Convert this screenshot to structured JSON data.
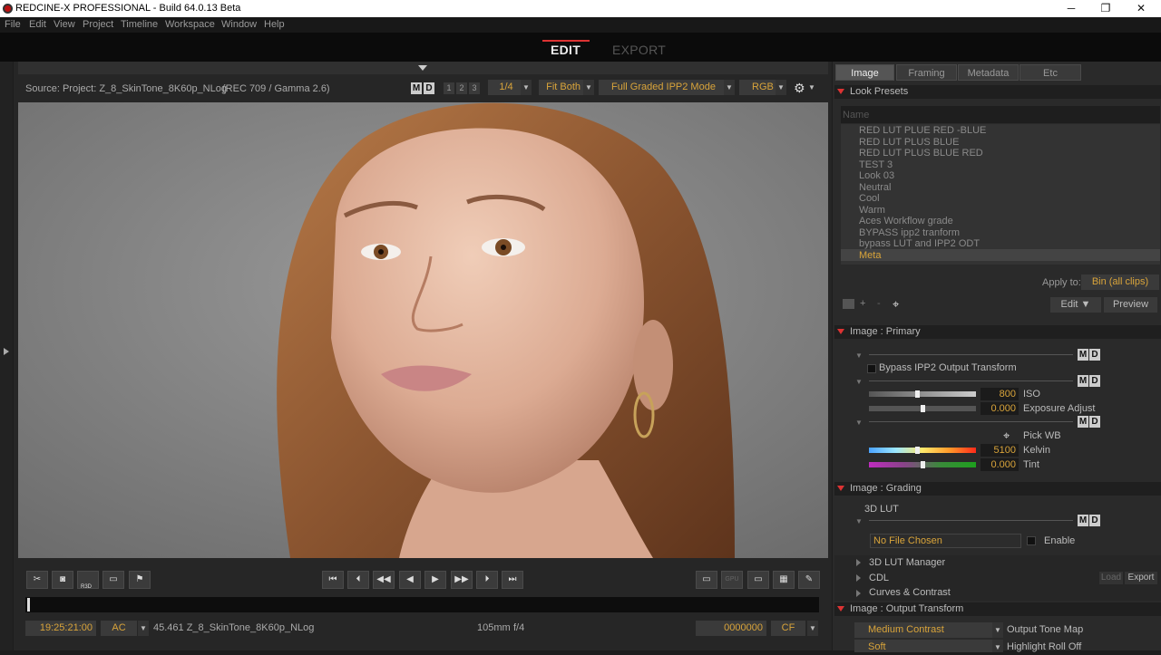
{
  "window": {
    "title": "REDCINE-X PROFESSIONAL - Build 64.0.13 Beta",
    "controls": [
      "─",
      "❐",
      "✕"
    ]
  },
  "menu": [
    "File",
    "Edit",
    "View",
    "Project",
    "Timeline",
    "Workspace",
    "Window",
    "Help"
  ],
  "modes": {
    "edit": "EDIT",
    "export": "EXPORT"
  },
  "viewer": {
    "source": "Source: Project: Z_8_SkinTone_8K60p_NLog",
    "colorspace": "(REC 709 / Gamma 2.6)",
    "md": [
      "M",
      "D"
    ],
    "nums": [
      "1",
      "2",
      "3"
    ],
    "resolution": "1/4",
    "fit": "Fit Both",
    "mode": "Full Graded IPP2 Mode",
    "channel": "RGB"
  },
  "transport": {
    "timecode": "19:25:21:00",
    "ac": "AC",
    "clip": "45.461 Z_8_SkinTone_8K60p_NLog",
    "lens": "105mm",
    "aperture": "f/4",
    "frame": "0000000",
    "cf": "CF",
    "gpu": "GPU",
    "r3d": "R3D"
  },
  "panel": {
    "tabs": [
      "Image",
      "Framing",
      "Metadata",
      "Etc"
    ],
    "look_presets": {
      "header": "Look Presets",
      "name_placeholder": "Name",
      "items": [
        "RED LUT PLUE RED -BLUE",
        "RED LUT PLUS BLUE",
        "RED LUT PLUS BLUE RED",
        "TEST 3",
        "Look 03",
        "Neutral",
        "Cool",
        "Warm",
        "Aces Workflow grade",
        "BYPASS ipp2 tranform",
        "bypass LUT and IPP2 ODT",
        "Meta"
      ],
      "selected": "Meta",
      "apply_to_label": "Apply to:",
      "apply_to_value": "Bin (all clips)",
      "edit": "Edit",
      "preview": "Preview"
    },
    "primary": {
      "header": "Image : Primary",
      "bypass": "Bypass IPP2 Output Transform",
      "iso_value": "800",
      "iso_label": "ISO",
      "iso_level": 0.45,
      "exposure_value": "0.000",
      "exposure_label": "Exposure Adjust",
      "exposure_level": 0.5,
      "pickwb": "Pick WB",
      "kelvin_value": "5100",
      "kelvin_label": "Kelvin",
      "kelvin_level": 0.45,
      "tint_value": "0.000",
      "tint_label": "Tint",
      "tint_level": 0.5
    },
    "grading": {
      "header": "Image : Grading",
      "lut3d": "3D LUT",
      "no_file": "No File Chosen",
      "enable": "Enable",
      "lut_manager": "3D LUT Manager",
      "cdl": "CDL",
      "load": "Load",
      "export": "Export",
      "curves": "Curves & Contrast"
    },
    "output": {
      "header": "Image : Output Transform",
      "tonemap_value": "Medium Contrast",
      "tonemap_label": "Output Tone Map",
      "rolloff_value": "Soft",
      "rolloff_label": "Highlight Roll Off"
    }
  },
  "colors": {
    "accent": "#d9a43a",
    "red": "#dd3333"
  }
}
